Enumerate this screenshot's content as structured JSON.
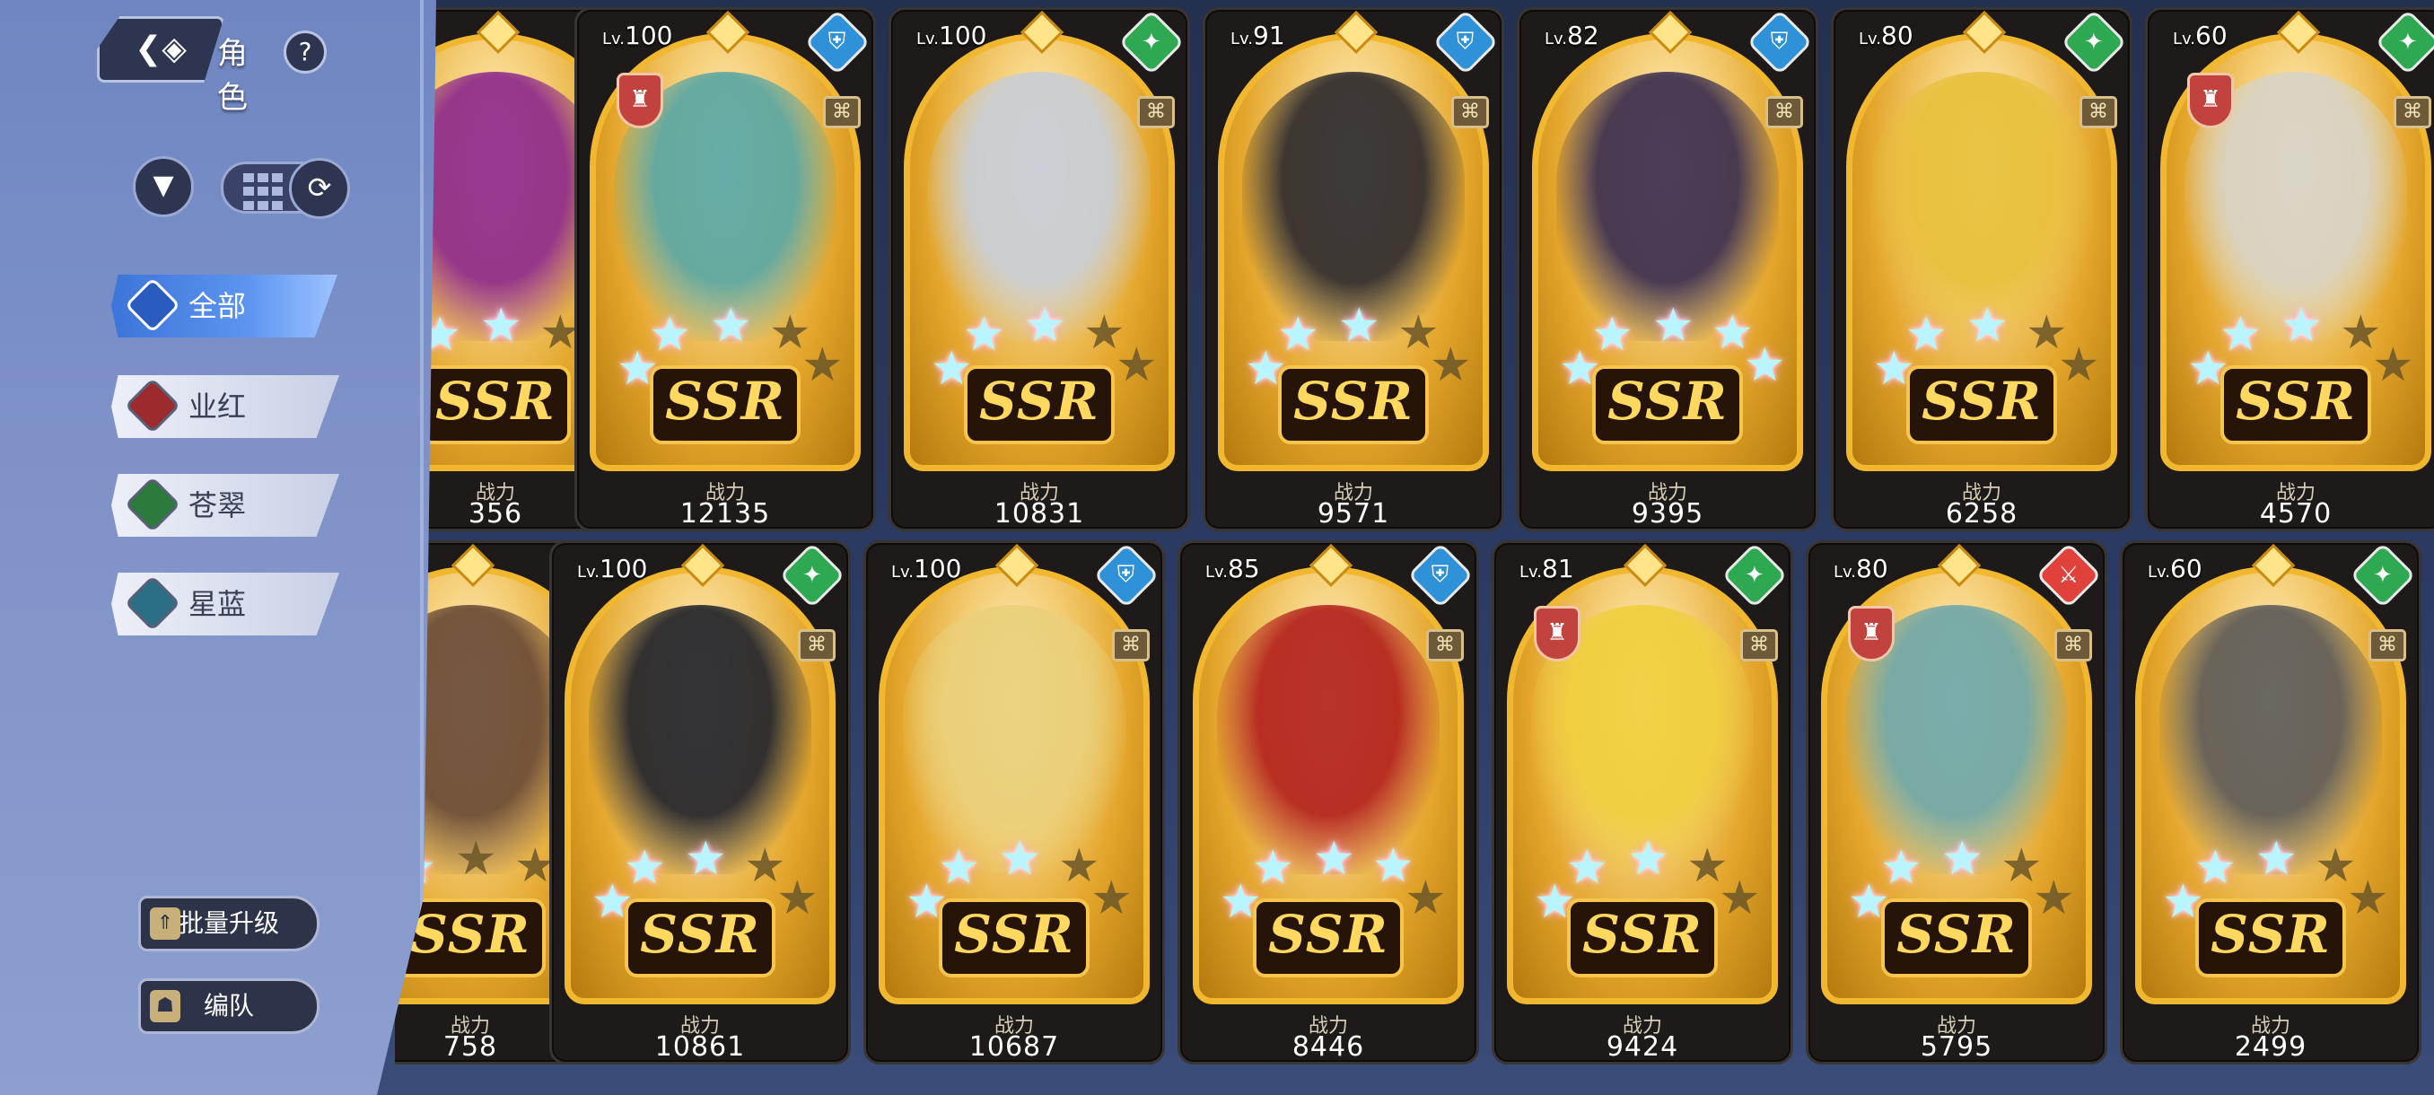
{
  "header": {
    "back_icon": "back-arrow-icon",
    "title": "角色",
    "help_label": "?"
  },
  "controls": {
    "filter_icon": "funnel-icon",
    "grid_icon": "grid-view-icon",
    "refresh_icon": "refresh-icon"
  },
  "tabs": [
    {
      "label": "全部",
      "active": true,
      "color": "#3d74d9"
    },
    {
      "label": "业红",
      "active": false,
      "color": "#9d2b2e"
    },
    {
      "label": "苍翠",
      "active": false,
      "color": "#2c7b3c"
    },
    {
      "label": "星蓝",
      "active": false,
      "color": "#2b6f86"
    }
  ],
  "bottom_buttons": {
    "batch_upgrade": "批量升级",
    "team": "编队"
  },
  "power_label": "战力",
  "level_prefix": "Lv.",
  "rarity_label": "SSR",
  "cards": [
    {
      "level": "",
      "element": "red",
      "power": "356",
      "lit_stars": 3,
      "badge": false,
      "tone": "#8e2a8a"
    },
    {
      "level": "100",
      "element": "blue",
      "power": "12135",
      "lit_stars": 3,
      "badge": true,
      "tone": "#5aa6a2"
    },
    {
      "level": "100",
      "element": "green",
      "power": "10831",
      "lit_stars": 3,
      "badge": false,
      "tone": "#c8cdd6"
    },
    {
      "level": "91",
      "element": "blue",
      "power": "9571",
      "lit_stars": 3,
      "badge": false,
      "tone": "#2e2a2c"
    },
    {
      "level": "82",
      "element": "blue",
      "power": "9395",
      "lit_stars": 5,
      "badge": false,
      "tone": "#3b2e4e"
    },
    {
      "level": "80",
      "element": "green",
      "power": "6258",
      "lit_stars": 3,
      "badge": false,
      "tone": "#e8c03a"
    },
    {
      "level": "60",
      "element": "green",
      "power": "4570",
      "lit_stars": 3,
      "badge": true,
      "tone": "#d7d3c6"
    },
    {
      "level": "",
      "element": "green",
      "power": "758",
      "lit_stars": 2,
      "badge": false,
      "tone": "#6a4a35"
    },
    {
      "level": "100",
      "element": "green",
      "power": "10861",
      "lit_stars": 3,
      "badge": false,
      "tone": "#22232a"
    },
    {
      "level": "100",
      "element": "blue",
      "power": "10687",
      "lit_stars": 3,
      "badge": false,
      "tone": "#e9d07a"
    },
    {
      "level": "85",
      "element": "blue",
      "power": "8446",
      "lit_stars": 4,
      "badge": false,
      "tone": "#b3221c"
    },
    {
      "level": "81",
      "element": "green",
      "power": "9424",
      "lit_stars": 3,
      "badge": true,
      "tone": "#f0cf3c"
    },
    {
      "level": "80",
      "element": "red",
      "power": "5795",
      "lit_stars": 3,
      "badge": true,
      "tone": "#6fa7a8"
    },
    {
      "level": "60",
      "element": "green",
      "power": "2499",
      "lit_stars": 3,
      "badge": false,
      "tone": "#5e5b57"
    }
  ]
}
